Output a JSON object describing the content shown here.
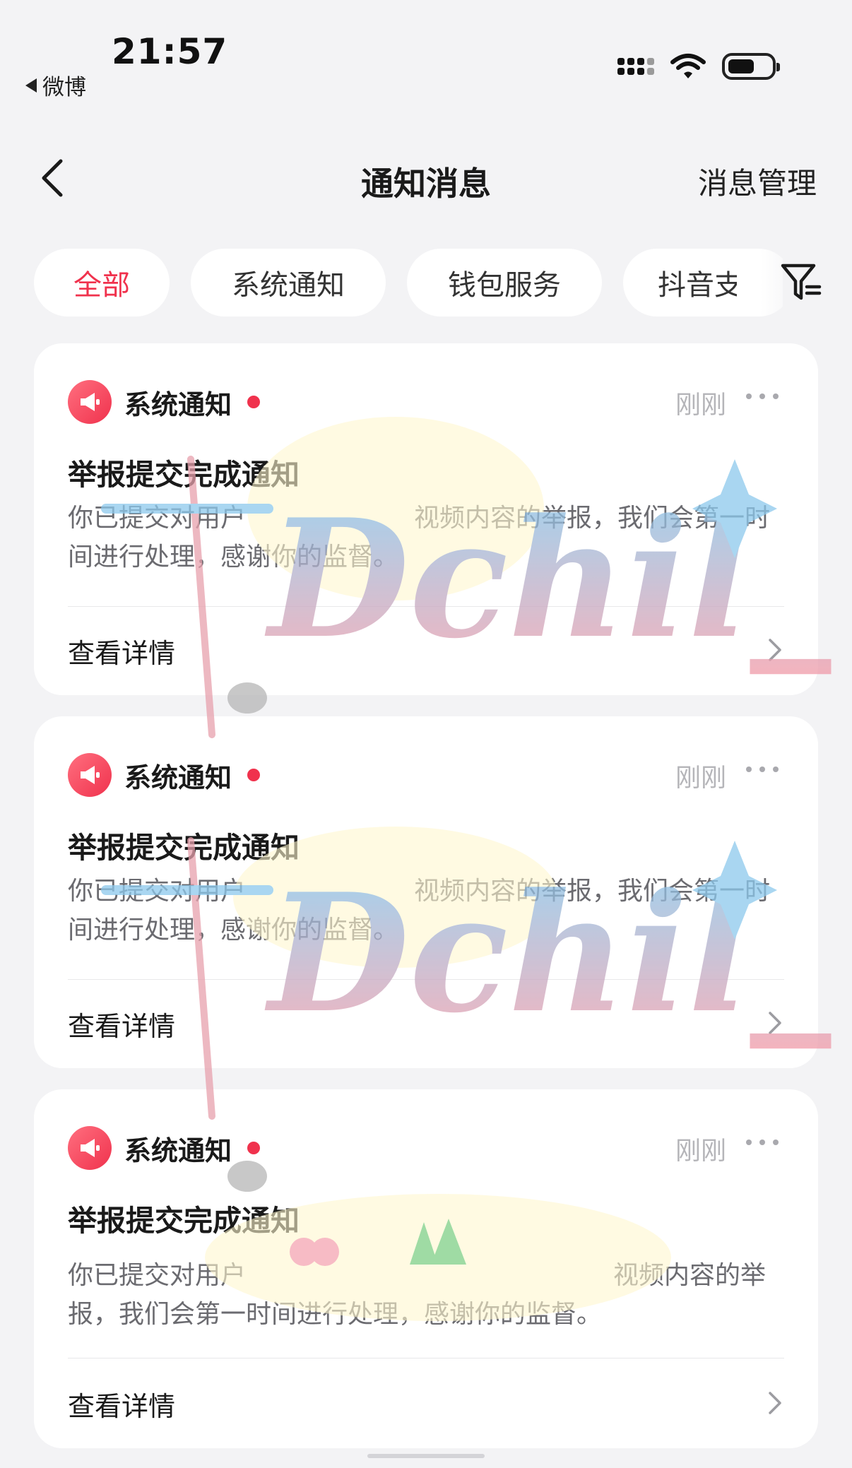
{
  "status_bar": {
    "time": "21:57",
    "back_app": "微博"
  },
  "nav": {
    "title": "通知消息",
    "manage_label": "消息管理"
  },
  "tabs": [
    {
      "label": "全部",
      "active": true
    },
    {
      "label": "系统通知",
      "active": false
    },
    {
      "label": "钱包服务",
      "active": false
    },
    {
      "label": "抖音支",
      "active": false
    }
  ],
  "notifications": [
    {
      "sender": "系统通知",
      "time": "刚刚",
      "title": "举报提交完成通知",
      "body_before": "你已提交对用户",
      "body_after": "视频内容的举报，我们会第一时间进行处理，感谢你的监督。",
      "detail_label": "查看详情"
    },
    {
      "sender": "系统通知",
      "time": "刚刚",
      "title": "举报提交完成通知",
      "body_before": "你已提交对用户",
      "body_after": "视频内容的举报，我们会第一时间进行处理，感谢你的监督。",
      "detail_label": "查看详情"
    },
    {
      "sender": "系统通知",
      "time": "刚刚",
      "title": "举报提交完成通知",
      "body_before": "你已提交对用户",
      "body_after": "视频内容的举报，我们会第一时间进行处理，感谢你的监督。",
      "detail_label": "查看详情"
    }
  ],
  "watermark": {
    "text": "Dchil_"
  },
  "colors": {
    "accent": "#f0324d",
    "background": "#f3f3f5",
    "card": "#ffffff",
    "muted_text": "#6b6b70"
  }
}
